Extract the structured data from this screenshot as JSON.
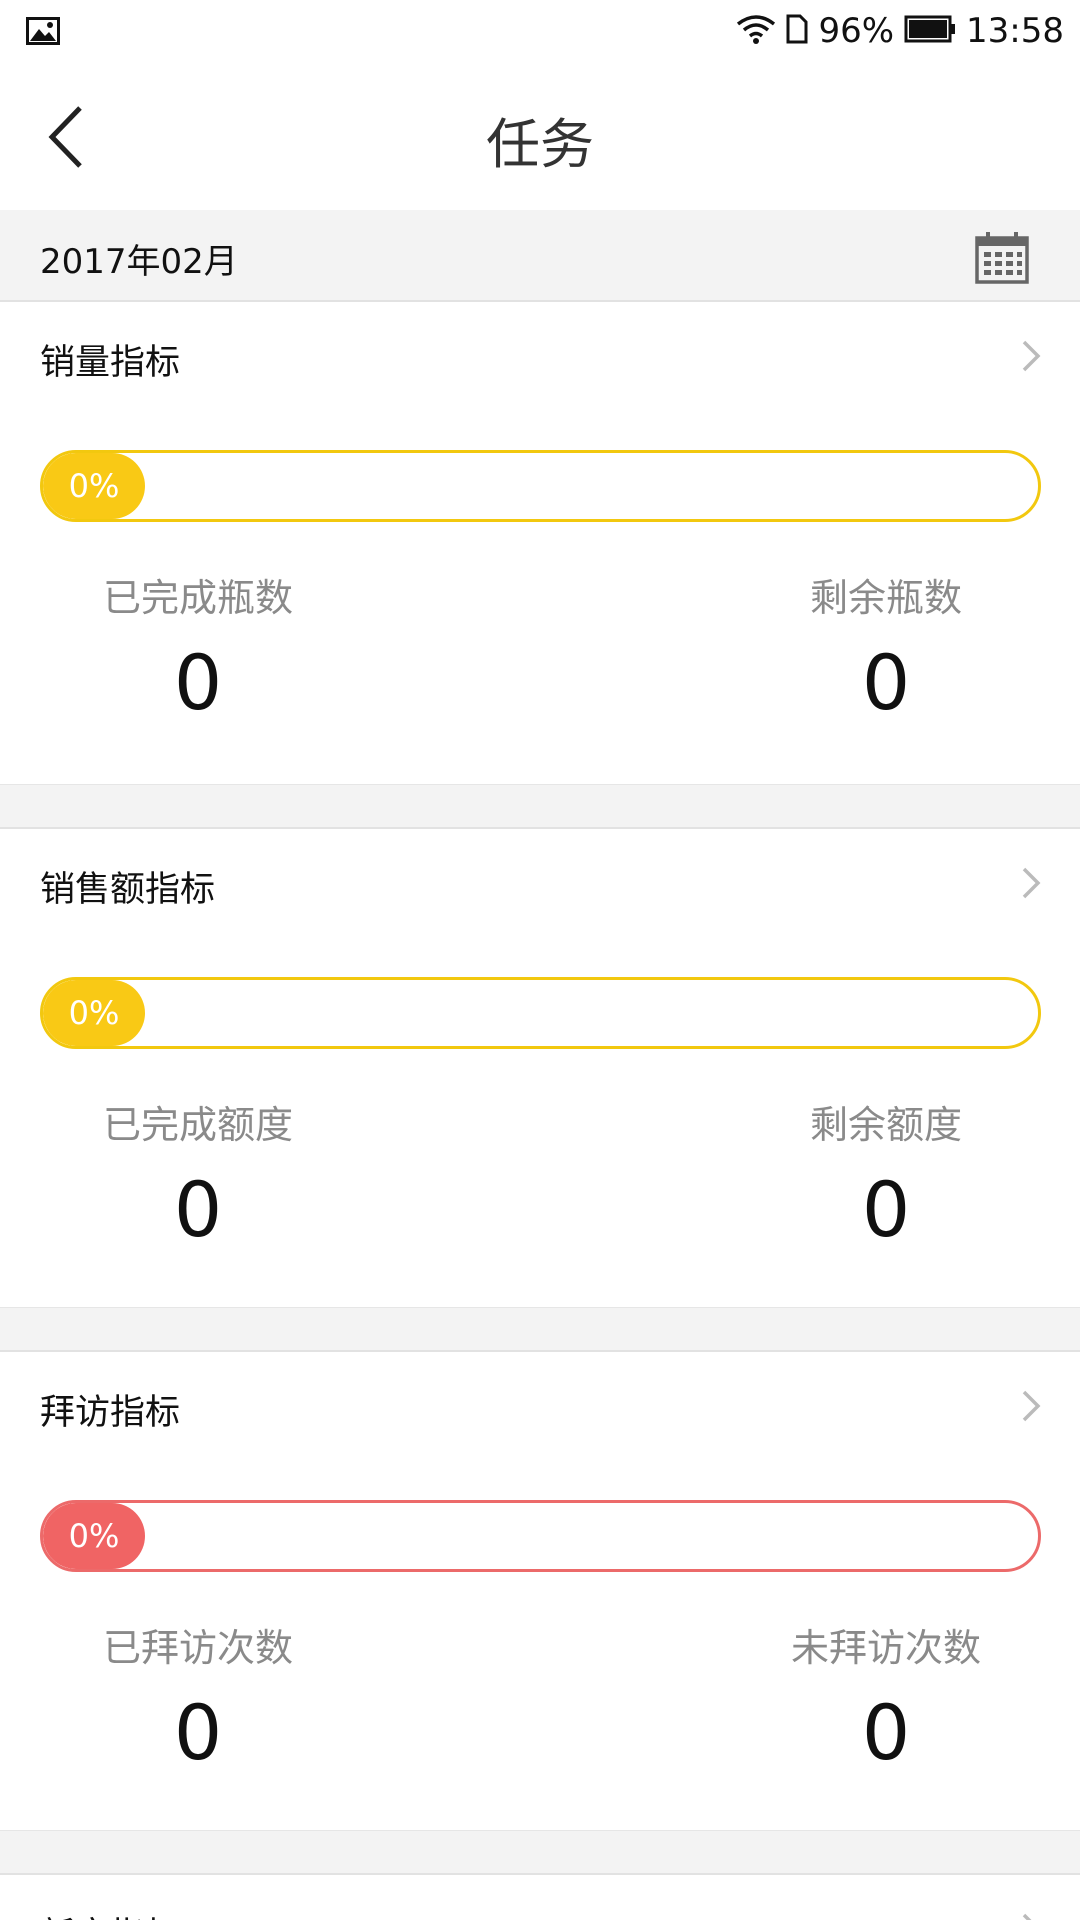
{
  "status_bar": {
    "battery": "96%",
    "time": "13:58",
    "icons": [
      "image-icon",
      "wifi-icon",
      "sim-card-icon",
      "battery-icon"
    ]
  },
  "header": {
    "title": "任务"
  },
  "month": "2017年02月",
  "cards": [
    {
      "title": "销量指标",
      "progress_text": "0%",
      "progress": 0,
      "color": "#f9c915",
      "left_label": "已完成瓶数",
      "left_value": "0",
      "right_label": "剩余瓶数",
      "right_value": "0"
    },
    {
      "title": "销售额指标",
      "progress_text": "0%",
      "progress": 0,
      "color": "#f9c915",
      "left_label": "已完成额度",
      "left_value": "0",
      "right_label": "剩余额度",
      "right_value": "0"
    },
    {
      "title": "拜访指标",
      "progress_text": "0%",
      "progress": 0,
      "color": "#f06464",
      "left_label": "已拜访次数",
      "left_value": "0",
      "right_label": "未拜访次数",
      "right_value": "0"
    },
    {
      "title": "新客指标"
    }
  ]
}
